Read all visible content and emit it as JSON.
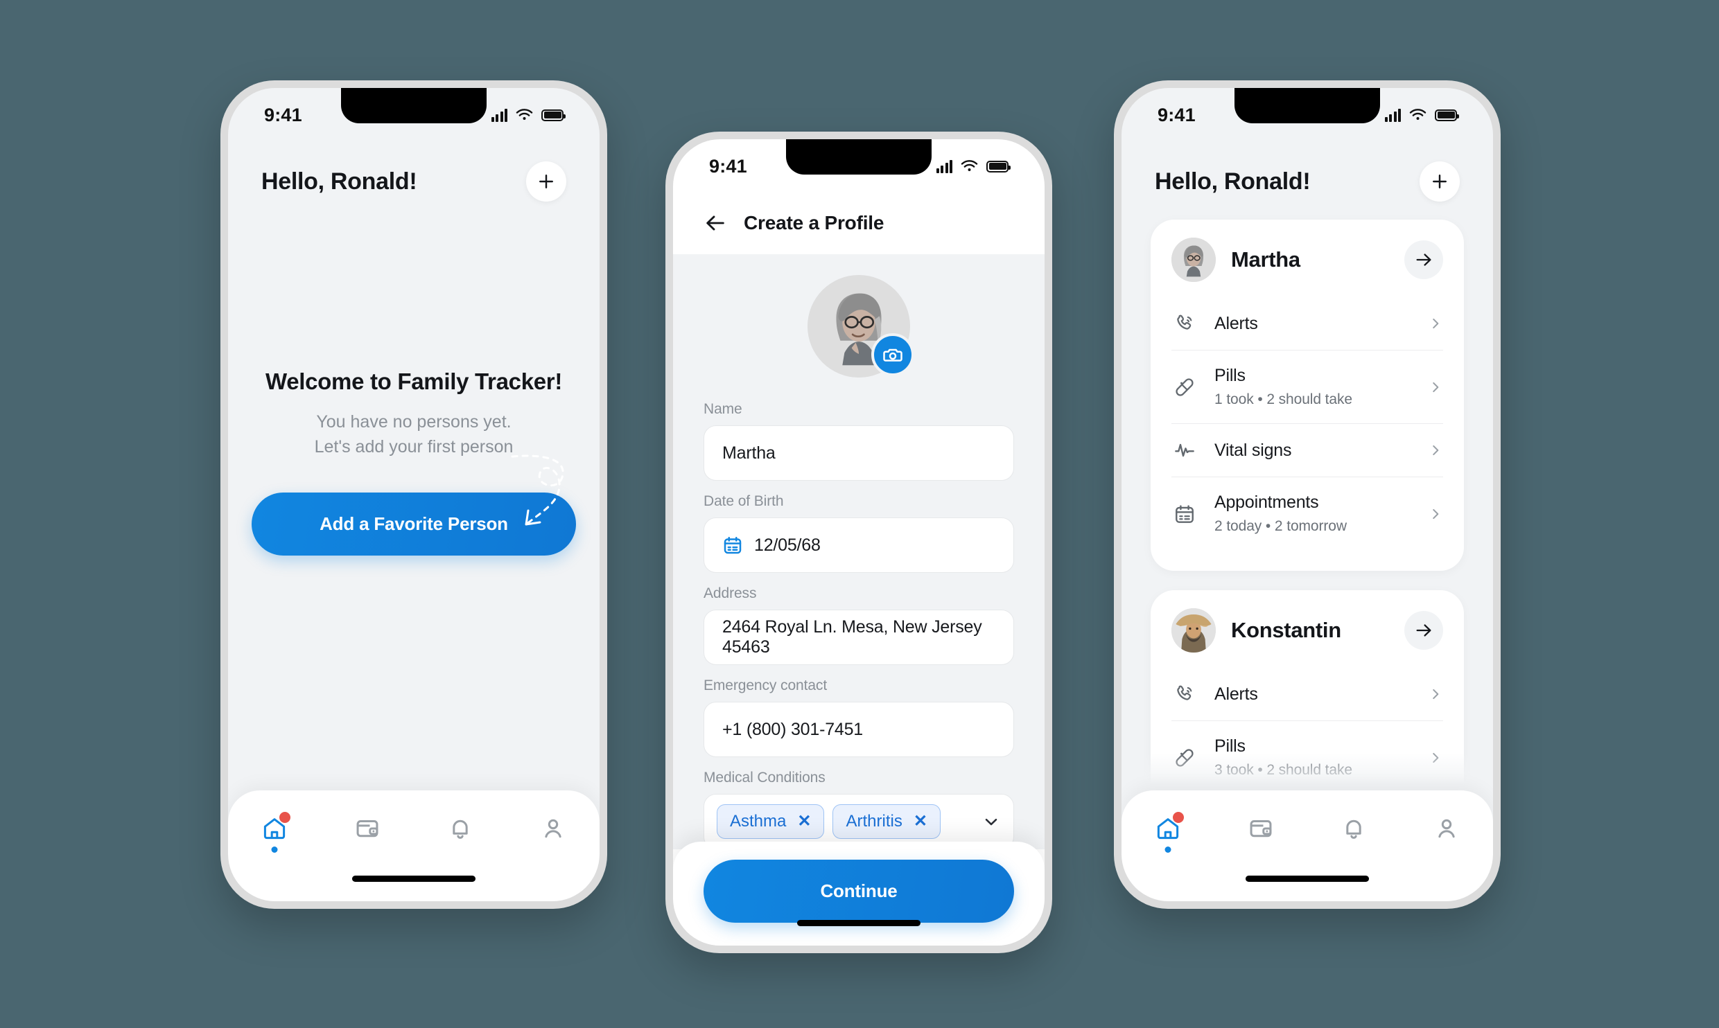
{
  "theme": {
    "background": "#4a6670",
    "accent": "#1186e0",
    "badge_red": "#e8534a",
    "chip_blue": "#1a6fd4"
  },
  "status_bar": {
    "time": "9:41"
  },
  "home_screen": {
    "greeting": "Hello, Ronald!",
    "add_button_icon": "plus-icon",
    "empty_title": "Welcome to Family Tracker!",
    "empty_line1": "You have no persons yet.",
    "empty_line2": "Let's add your first person",
    "cta_label": "Add a Favorite Person",
    "tabs": [
      {
        "name": "home",
        "icon": "home-icon",
        "active": true,
        "badge": true
      },
      {
        "name": "wallet",
        "icon": "wallet-icon",
        "active": false,
        "badge": false
      },
      {
        "name": "notifications",
        "icon": "bell-icon",
        "active": false,
        "badge": false
      },
      {
        "name": "profile",
        "icon": "person-icon",
        "active": false,
        "badge": false
      }
    ]
  },
  "create_profile": {
    "back_icon": "arrow-left-icon",
    "title": "Create a Profile",
    "avatar_alt": "Martha avatar",
    "camera_icon": "camera-icon",
    "fields": [
      {
        "label": "Name",
        "value": "Martha",
        "icon": null
      },
      {
        "label": "Date of Birth",
        "value": "12/05/68",
        "icon": "calendar-icon"
      },
      {
        "label": "Address",
        "value": "2464 Royal Ln. Mesa, New Jersey 45463",
        "icon": null
      },
      {
        "label": "Emergency contact",
        "value": "+1 (800) 301-7451",
        "icon": null
      }
    ],
    "medical_label": "Medical Conditions",
    "medical_chips": [
      "Asthma",
      "Arthritis"
    ],
    "medical_dropdown_icon": "chevron-down-icon",
    "continue_label": "Continue"
  },
  "people_screen": {
    "greeting": "Hello, Ronald!",
    "add_button_icon": "plus-icon",
    "people": [
      {
        "name": "Martha",
        "go_icon": "arrow-right-icon",
        "rows": [
          {
            "title": "Alerts",
            "subtitle": "",
            "icon": "phone-ring-icon"
          },
          {
            "title": "Pills",
            "subtitle": "1 took  •  2 should take",
            "icon": "pill-icon"
          },
          {
            "title": "Vital signs",
            "subtitle": "",
            "icon": "pulse-icon"
          },
          {
            "title": "Appointments",
            "subtitle": "2 today  •  2 tomorrow",
            "icon": "calendar-icon"
          }
        ]
      },
      {
        "name": "Konstantin",
        "go_icon": "arrow-right-icon",
        "rows": [
          {
            "title": "Alerts",
            "subtitle": "",
            "icon": "phone-ring-icon"
          },
          {
            "title": "Pills",
            "subtitle": "3 took  •  2 should take",
            "icon": "pill-icon"
          }
        ]
      }
    ],
    "tabs": [
      {
        "name": "home",
        "icon": "home-icon",
        "active": true,
        "badge": true
      },
      {
        "name": "wallet",
        "icon": "wallet-icon",
        "active": false,
        "badge": false
      },
      {
        "name": "notifications",
        "icon": "bell-icon",
        "active": false,
        "badge": false
      },
      {
        "name": "profile",
        "icon": "person-icon",
        "active": false,
        "badge": false
      }
    ]
  }
}
